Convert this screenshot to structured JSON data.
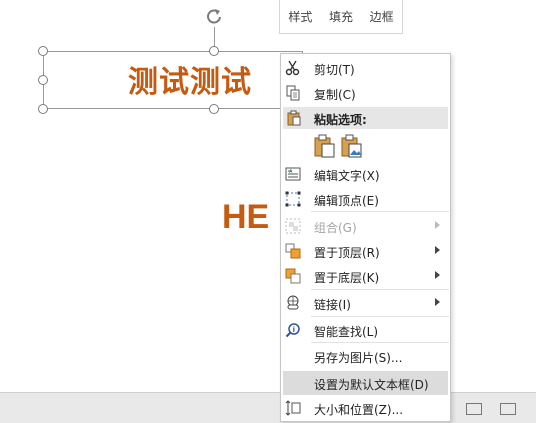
{
  "slide": {
    "title_text": "测试测试",
    "body_text": "HE"
  },
  "mini_toolbar": {
    "items": [
      "样式",
      "填充",
      "边框"
    ]
  },
  "context_menu": {
    "items": [
      {
        "label": "剪切(T)",
        "icon": "scissors-icon"
      },
      {
        "label": "复制(C)",
        "icon": "copy-icon"
      },
      {
        "label": "编辑文字(X)",
        "icon": "edit-text-icon"
      },
      {
        "label": "编辑顶点(E)",
        "icon": "edit-points-icon"
      },
      {
        "label": "组合(G)",
        "icon": "group-icon",
        "disabled": true
      },
      {
        "label": "置于顶层(R)",
        "icon": "bring-to-front-icon"
      },
      {
        "label": "置于底层(K)",
        "icon": "send-to-back-icon"
      },
      {
        "label": "链接(I)",
        "icon": "link-icon"
      },
      {
        "label": "智能查找(L)",
        "icon": "smart-lookup-icon"
      },
      {
        "label": "另存为图片(S)...",
        "icon": ""
      },
      {
        "label": "设置为默认文本框(D)",
        "icon": ""
      },
      {
        "label": "大小和位置(Z)...",
        "icon": "size-position-icon"
      }
    ],
    "paste_header": "粘贴选项:",
    "paste_options": [
      "paste-keep-icon",
      "paste-picture-icon"
    ]
  },
  "colors": {
    "accent_text": "#c55a11",
    "hover_bg": "#dcdcdc"
  }
}
